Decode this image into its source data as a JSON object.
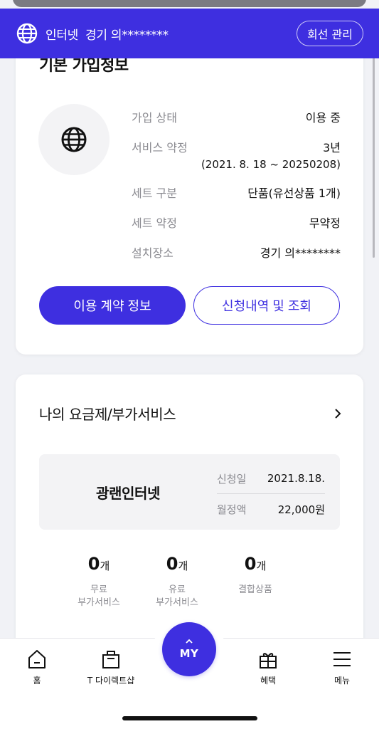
{
  "header": {
    "service": "인터넷",
    "location": "경기 의********",
    "manage_button": "회선 관리"
  },
  "subscription": {
    "title": "기본 가입정보",
    "rows": [
      {
        "label": "가입 상태",
        "value": "이용 중",
        "sub": ""
      },
      {
        "label": "서비스 약정",
        "value": "3년",
        "sub": "(2021. 8. 18 ~ 20250208)"
      },
      {
        "label": "세트 구분",
        "value": "단품(유선상품 1개)",
        "sub": ""
      },
      {
        "label": "세트 약정",
        "value": "무약정",
        "sub": ""
      },
      {
        "label": "설치장소",
        "value": "경기 의********",
        "sub": ""
      }
    ],
    "primary_button": "이용 계약 정보",
    "secondary_button": "신청내역 및 조회"
  },
  "plan": {
    "section_title": "나의 요금제/부가서비스",
    "plan_name": "광랜인터넷",
    "apply_label": "신청일",
    "apply_value": "2021.8.18.",
    "monthly_label": "월정액",
    "monthly_value": "22,000원",
    "stats": [
      {
        "count": "0",
        "unit": "개",
        "label_line1": "무료",
        "label_line2": "부가서비스"
      },
      {
        "count": "0",
        "unit": "개",
        "label_line1": "유료",
        "label_line2": "부가서비스"
      },
      {
        "count": "0",
        "unit": "개",
        "label_line1": "결합상품",
        "label_line2": ""
      }
    ]
  },
  "nav": {
    "home": "홈",
    "shop": "T 다이렉트샵",
    "my": "MY",
    "benefit": "혜택",
    "menu": "메뉴"
  },
  "colors": {
    "accent": "#3e2fe0",
    "muted_text": "#8a8a90",
    "background": "#f1f2f6"
  },
  "icons": [
    "globe-icon",
    "chevron-right-icon",
    "home-icon",
    "shopping-bag-icon",
    "caret-up-icon",
    "gift-icon",
    "hamburger-menu-icon"
  ]
}
